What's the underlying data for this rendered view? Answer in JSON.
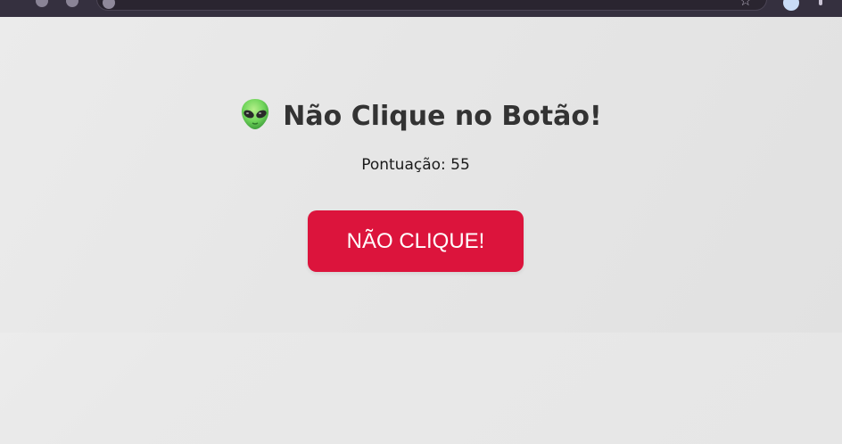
{
  "browser": {
    "star_icon": "star-icon",
    "profile_icon": "profile-avatar",
    "menu_icon": "kebab-menu-icon"
  },
  "game": {
    "title_icon": "alien-emoji",
    "title": "Não Clique no Botão!",
    "score_label": "Pontuação:",
    "score_value": "55",
    "button_label": "NÃO CLIQUE!"
  },
  "colors": {
    "button": "#dc143c",
    "title_text": "#333333",
    "background": "#e8e8e8"
  }
}
